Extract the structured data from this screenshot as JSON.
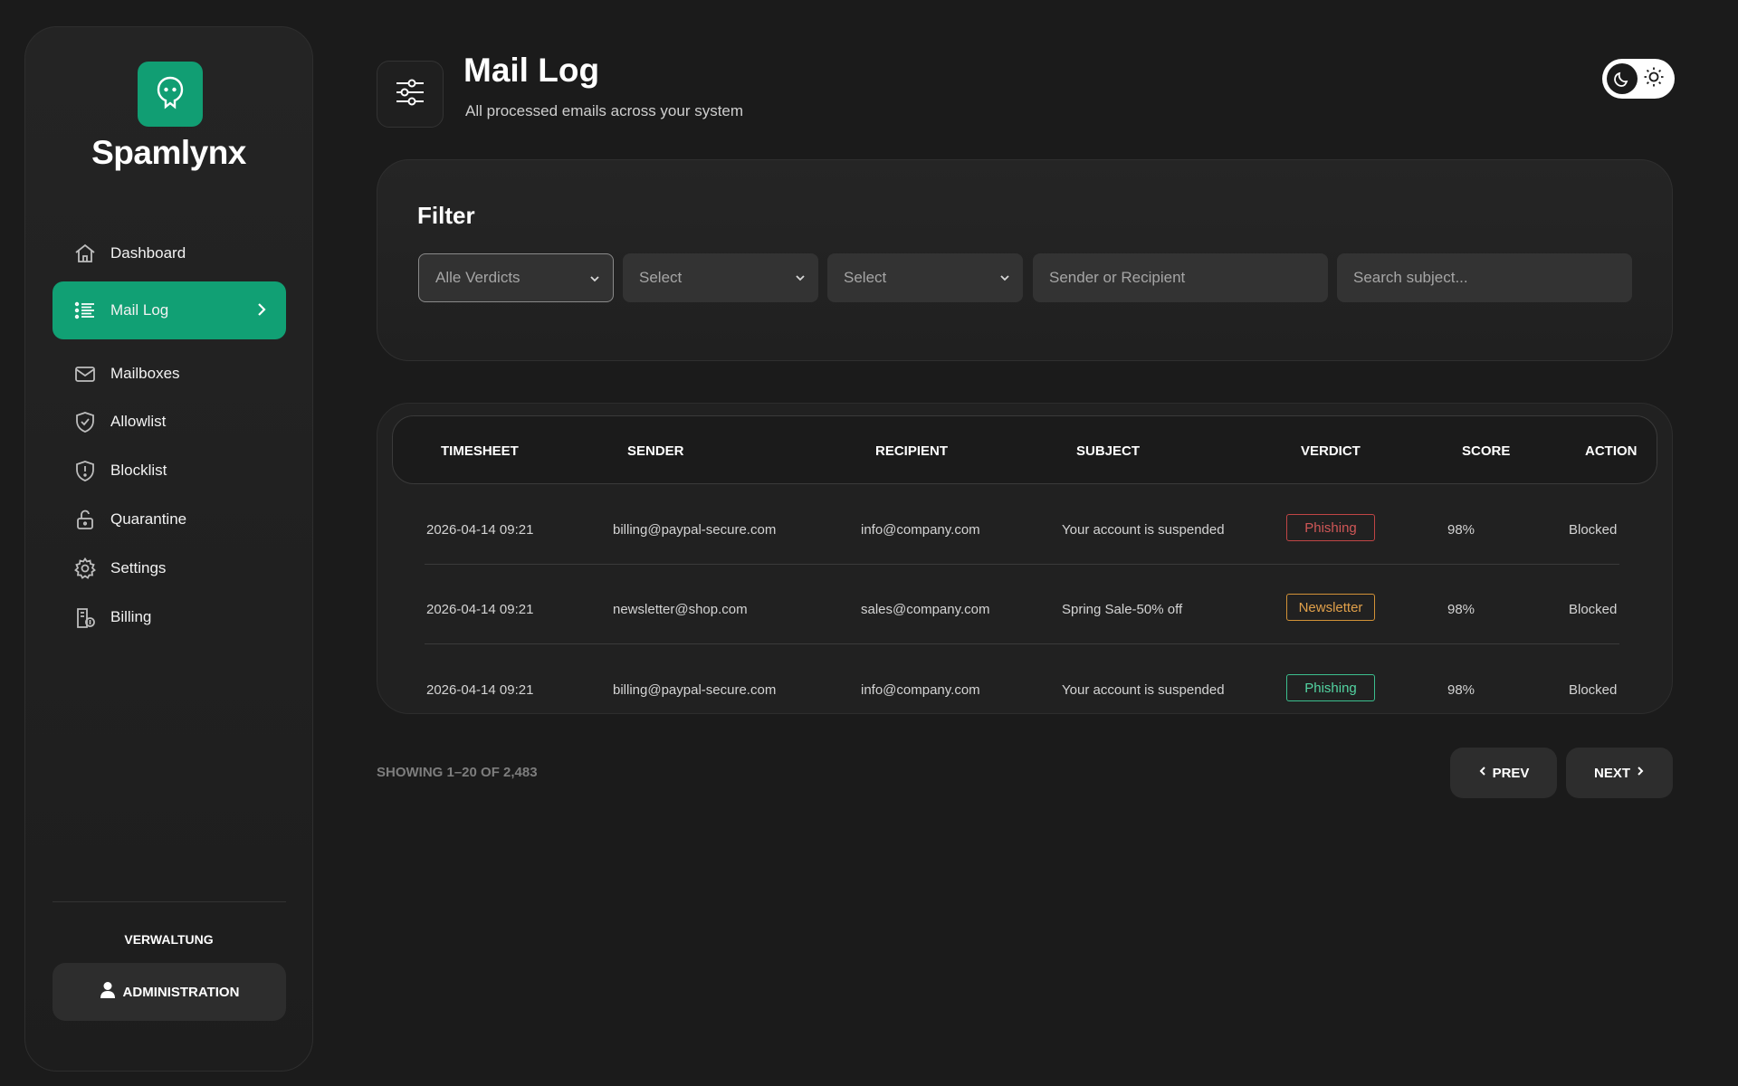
{
  "brand": {
    "name": "Spamlynx",
    "logo_icon": "ghost-icon",
    "accent": "#119e73"
  },
  "sidebar": {
    "items": [
      {
        "label": "Dashboard",
        "icon": "home-icon",
        "active": false
      },
      {
        "label": "Mail Log",
        "icon": "list-icon",
        "active": true
      },
      {
        "label": "Mailboxes",
        "icon": "mail-icon",
        "active": false
      },
      {
        "label": "Allowlist",
        "icon": "shield-check-icon",
        "active": false
      },
      {
        "label": "Blocklist",
        "icon": "shield-alert-icon",
        "active": false
      },
      {
        "label": "Quarantine",
        "icon": "lock-icon",
        "active": false
      },
      {
        "label": "Settings",
        "icon": "gear-icon",
        "active": false
      },
      {
        "label": "Billing",
        "icon": "billing-icon",
        "active": false
      }
    ],
    "section_label": "VERWALTUNG",
    "admin_button": "ADMINISTRATION"
  },
  "header": {
    "title": "Mail Log",
    "subtitle": "All processed emails across your system",
    "icon": "sliders-icon",
    "theme": "dark"
  },
  "filter": {
    "title": "Filter",
    "verdict_select": "Alle Verdicts",
    "select_2": "Select",
    "select_3": "Select",
    "sender_placeholder": "Sender or Recipient",
    "subject_placeholder": "Search subject..."
  },
  "table": {
    "columns": [
      "TIMESHEET",
      "SENDER",
      "RECIPIENT",
      "SUBJECT",
      "VERDICT",
      "SCORE",
      "ACTION"
    ],
    "rows": [
      {
        "time": "2026-04-14  09:21",
        "sender": "billing@paypal-secure.com",
        "recipient": "info@company.com",
        "subject": "Your account is suspended",
        "verdict": "Phishing",
        "verdict_color": "#d05757",
        "score": "98%",
        "action": "Blocked"
      },
      {
        "time": "2026-04-14  09:21",
        "sender": "newsletter@shop.com",
        "recipient": "sales@company.com",
        "subject": "Spring Sale-50% off",
        "verdict": "Newsletter",
        "verdict_color": "#e0a04a",
        "score": "98%",
        "action": "Blocked"
      },
      {
        "time": "2026-04-14  09:21",
        "sender": "billing@paypal-secure.com",
        "recipient": "info@company.com",
        "subject": "Your account is suspended",
        "verdict": "Phishing",
        "verdict_color": "#53d4a2",
        "score": "98%",
        "action": "Blocked"
      }
    ]
  },
  "pagination": {
    "showing": "SHOWING 1–20 OF 2,483",
    "prev": "PREV",
    "next": "NEXT"
  }
}
